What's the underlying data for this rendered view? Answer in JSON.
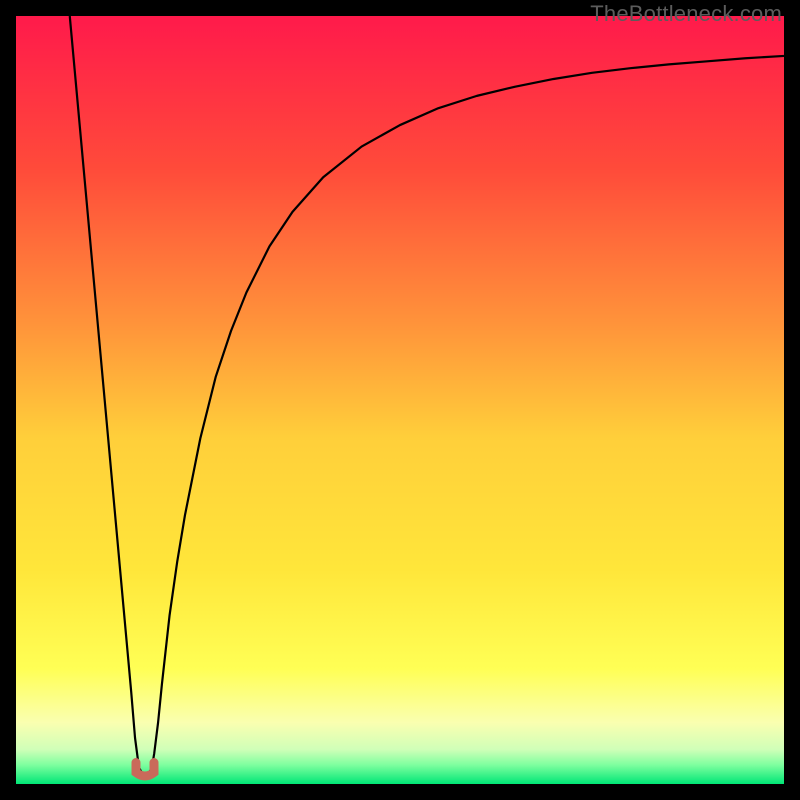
{
  "watermark": "TheBottleneck.com",
  "chart_data": {
    "type": "line",
    "title": "",
    "xlabel": "",
    "ylabel": "",
    "xlim": [
      0,
      100
    ],
    "ylim": [
      0,
      100
    ],
    "background": {
      "type": "vertical-gradient",
      "stops": [
        {
          "pos": 0.0,
          "color": "#ff1a4b"
        },
        {
          "pos": 0.2,
          "color": "#ff4b3a"
        },
        {
          "pos": 0.4,
          "color": "#ff933a"
        },
        {
          "pos": 0.55,
          "color": "#ffcf3a"
        },
        {
          "pos": 0.72,
          "color": "#ffe63a"
        },
        {
          "pos": 0.85,
          "color": "#ffff55"
        },
        {
          "pos": 0.92,
          "color": "#faffb0"
        },
        {
          "pos": 0.955,
          "color": "#d0ffb8"
        },
        {
          "pos": 0.975,
          "color": "#7fff9f"
        },
        {
          "pos": 1.0,
          "color": "#00e676"
        }
      ]
    },
    "series": [
      {
        "name": "bottleneck-curve",
        "stroke": "#000000",
        "x": [
          7.0,
          8,
          9,
          10,
          11,
          12,
          13,
          14,
          15,
          15.5,
          16,
          16.3,
          16.6,
          17,
          17.4,
          17.7,
          18,
          18.5,
          19,
          20,
          21,
          22,
          24,
          26,
          28,
          30,
          33,
          36,
          40,
          45,
          50,
          55,
          60,
          65,
          70,
          75,
          80,
          85,
          90,
          95,
          100
        ],
        "y": [
          100,
          89,
          78,
          67,
          56,
          45,
          34,
          23,
          12,
          6,
          2.2,
          1.6,
          1.4,
          1.4,
          1.6,
          2.2,
          4,
          8,
          13,
          22,
          29,
          35,
          45,
          53,
          59,
          64,
          70,
          74.5,
          79,
          83,
          85.8,
          88,
          89.6,
          90.8,
          91.8,
          92.6,
          93.2,
          93.7,
          94.1,
          94.5,
          94.8
        ]
      }
    ],
    "markers": [
      {
        "name": "valley-marker",
        "shape": "u",
        "x": 16.8,
        "y": 1.5,
        "color": "#c96a5a"
      }
    ],
    "grid": false,
    "legend": false
  }
}
